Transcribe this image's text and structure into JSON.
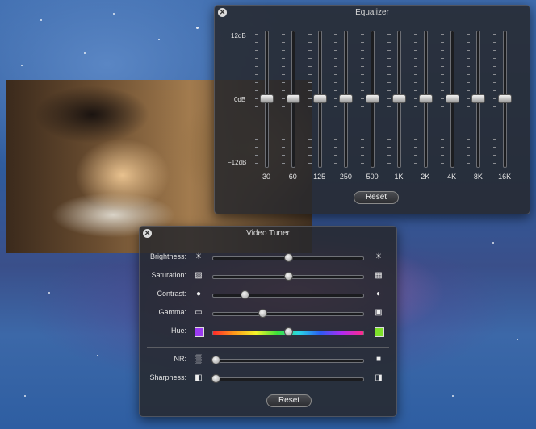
{
  "equalizer": {
    "title": "Equalizer",
    "db_labels": {
      "top": "12dB",
      "mid": "0dB",
      "bottom": "−12dB"
    },
    "bands": [
      {
        "freq": "30",
        "gain_db": 0
      },
      {
        "freq": "60",
        "gain_db": 0
      },
      {
        "freq": "125",
        "gain_db": 0
      },
      {
        "freq": "250",
        "gain_db": 0
      },
      {
        "freq": "500",
        "gain_db": 0
      },
      {
        "freq": "1K",
        "gain_db": 0
      },
      {
        "freq": "2K",
        "gain_db": 0
      },
      {
        "freq": "4K",
        "gain_db": 0
      },
      {
        "freq": "8K",
        "gain_db": 0
      },
      {
        "freq": "16K",
        "gain_db": 0
      }
    ],
    "reset_label": "Reset"
  },
  "tuner": {
    "title": "Video Tuner",
    "controls": [
      {
        "label": "Brightness:",
        "value": 0.5,
        "left_icon": "sun-small-icon",
        "right_icon": "sun-large-icon"
      },
      {
        "label": "Saturation:",
        "value": 0.5,
        "left_icon": "grayscale-icon",
        "right_icon": "color-icon"
      },
      {
        "label": "Contrast:",
        "value": 0.2,
        "left_icon": "dot-icon",
        "right_icon": "half-circle-icon"
      },
      {
        "label": "Gamma:",
        "value": 0.32,
        "left_icon": "gamma-low-icon",
        "right_icon": "gamma-high-icon"
      },
      {
        "label": "Hue:",
        "value": 0.5,
        "left_icon": "purple-swatch-icon",
        "right_icon": "green-swatch-icon"
      },
      {
        "label": "NR:",
        "value": 0.0,
        "left_icon": "noise-icon",
        "right_icon": "smooth-icon"
      },
      {
        "label": "Sharpness:",
        "value": 0.0,
        "left_icon": "soft-icon",
        "right_icon": "sharp-icon"
      }
    ],
    "reset_label": "Reset"
  },
  "colors": {
    "hud_bg": "#26282c",
    "hue_left": "#9b3bf2",
    "hue_right": "#7ee02a"
  }
}
